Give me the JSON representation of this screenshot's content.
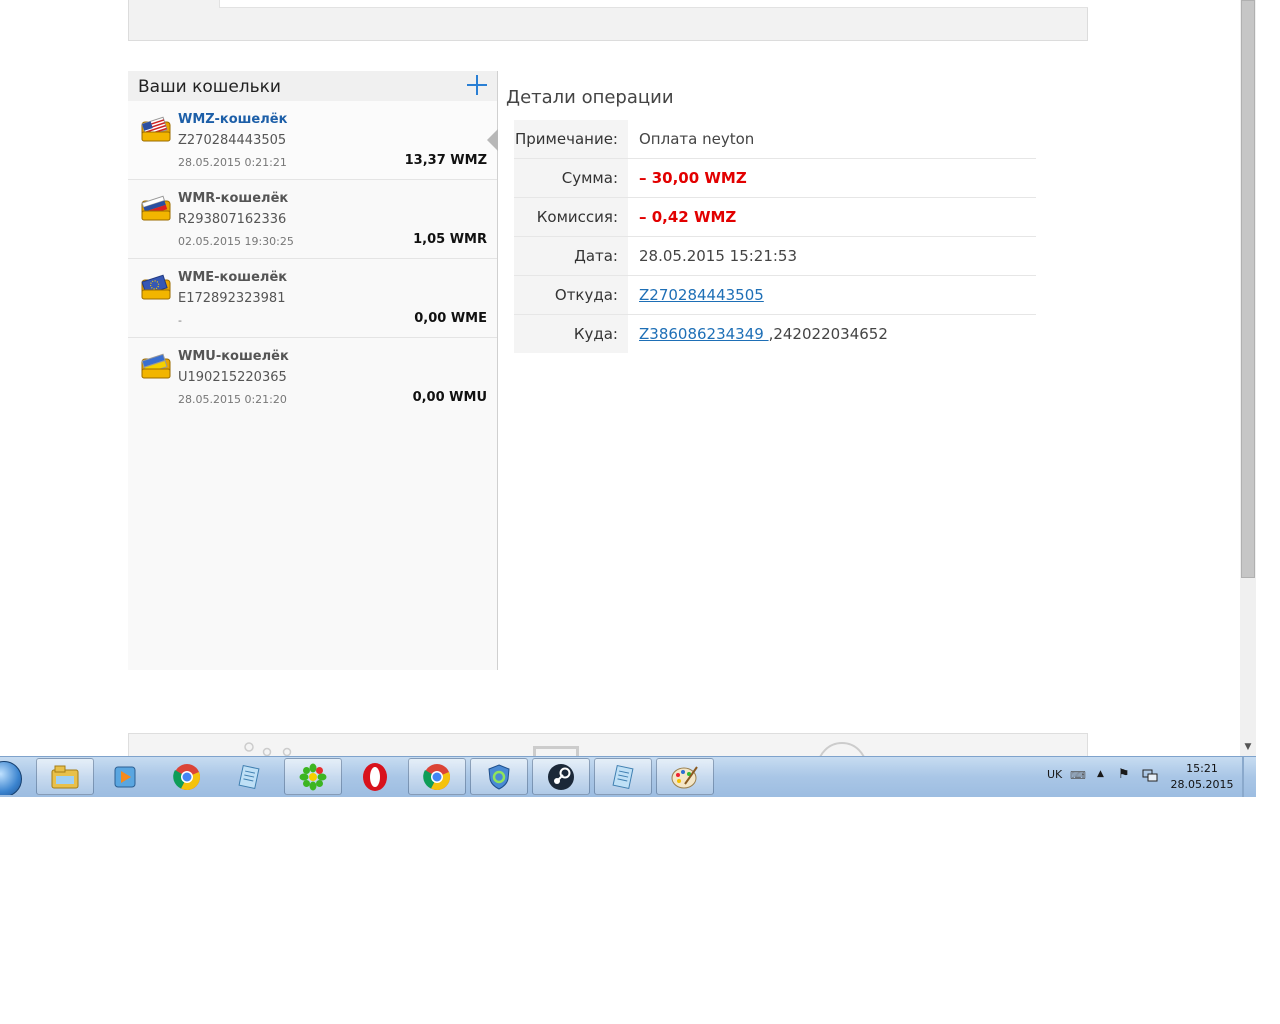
{
  "sidebar": {
    "title": "Ваши кошельки",
    "wallets": [
      {
        "name": "WMZ-кошелёк",
        "number": "Z270284443505",
        "date": "28.05.2015 0:21:21",
        "balance": "13,37 WMZ"
      },
      {
        "name": "WMR-кошелёк",
        "number": "R293807162336",
        "date": "02.05.2015 19:30:25",
        "balance": "1,05 WMR"
      },
      {
        "name": "WME-кошелёк",
        "number": "E172892323981",
        "date": "-",
        "balance": "0,00 WME"
      },
      {
        "name": "WMU-кошелёк",
        "number": "U190215220365",
        "date": "28.05.2015 0:21:20",
        "balance": "0,00 WMU"
      }
    ]
  },
  "details": {
    "title": "Детали операции",
    "rows": [
      {
        "label": "Примечание:",
        "value": "Оплата neyton"
      },
      {
        "label": "Сумма:",
        "value": "– 30,00 WMZ"
      },
      {
        "label": "Комиссия:",
        "value": "– 0,42 WMZ"
      },
      {
        "label": "Дата:",
        "value": "28.05.2015 15:21:53"
      },
      {
        "label": "Откуда:",
        "value": "Z270284443505"
      },
      {
        "label": "Куда:",
        "value": "Z386086234349 ",
        "suffix": ",242022034652"
      }
    ]
  },
  "taskbar": {
    "apps": [
      "explorer-icon",
      "media-player-icon",
      "chrome-icon",
      "notepad-icon",
      "icq-icon",
      "opera-icon",
      "chrome-icon",
      "shield-icon",
      "steam-icon",
      "notepad-icon",
      "paint-icon"
    ],
    "language": "UK",
    "time": "15:21",
    "date": "28.05.2015"
  },
  "colors": {
    "accent": "#1d5fa8",
    "negative": "#e20000",
    "link": "#1e6fb6"
  }
}
